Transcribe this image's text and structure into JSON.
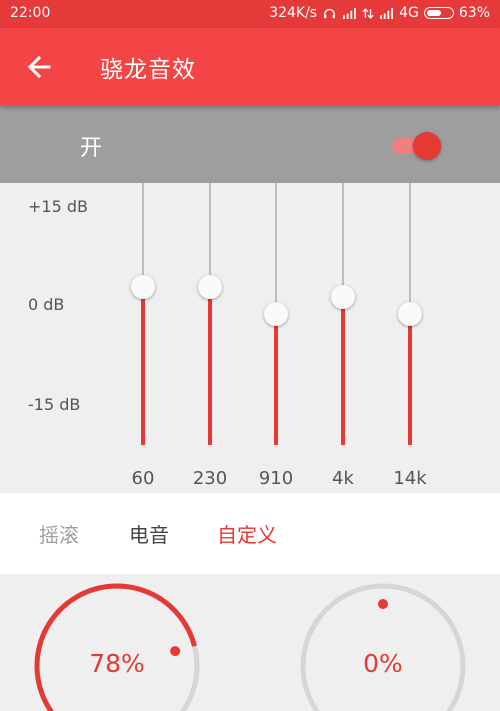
{
  "status_bar": {
    "time": "22:00",
    "network_speed": "324K/s",
    "network_type": "4G",
    "battery": "63%",
    "battery_level": 0.63,
    "icons": [
      "headphone-icon",
      "signal-icon",
      "data-arrows-icon",
      "signal-icon",
      "battery-icon"
    ]
  },
  "app_bar": {
    "title": "骁龙音效",
    "back_icon": "arrow-left-icon"
  },
  "switch": {
    "label": "开",
    "on": true
  },
  "equalizer": {
    "db_labels": [
      "+15 dB",
      "0 dB",
      "-15 dB"
    ],
    "db_range": [
      -15,
      15
    ],
    "bands": [
      {
        "freq": "60",
        "gain_db": 8.5
      },
      {
        "freq": "230",
        "gain_db": 8.5
      },
      {
        "freq": "910",
        "gain_db": 4.5
      },
      {
        "freq": "4k",
        "gain_db": 7
      },
      {
        "freq": "14k",
        "gain_db": 4.5
      }
    ]
  },
  "presets": {
    "items": [
      "摇滚",
      "电音",
      "自定义"
    ],
    "selected": "自定义"
  },
  "dials": [
    {
      "value": "78%",
      "level": 0.78
    },
    {
      "value": "0%",
      "level": 0
    }
  ],
  "colors": {
    "accent": "#e53935",
    "app_bar": "#f44546",
    "switch_bar": "#9e9e9e",
    "inactive_text": "#9e9e9e",
    "active_text": "#e53935",
    "normal_text": "#444444"
  }
}
